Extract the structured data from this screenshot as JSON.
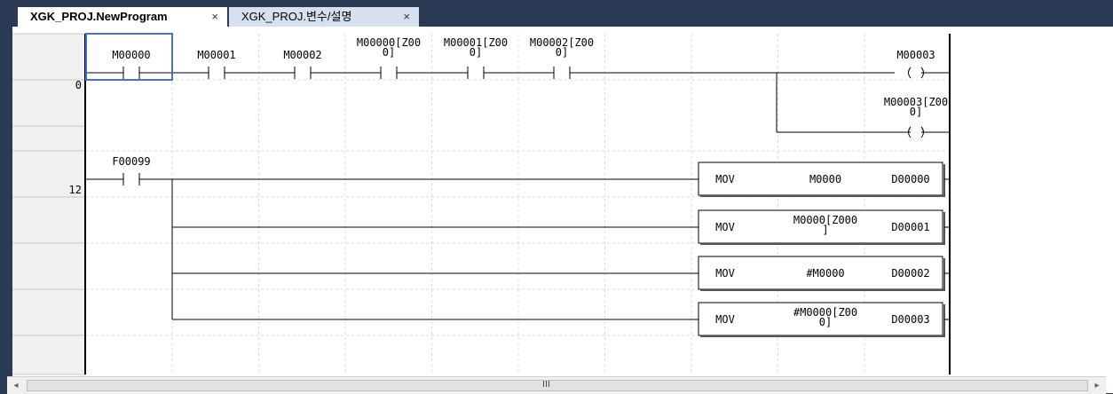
{
  "tabs": [
    {
      "label": "XGK_PROJ.NewProgram",
      "close": "×",
      "active": true
    },
    {
      "label": "XGK_PROJ.변수/설명",
      "close": "×",
      "active": false
    }
  ],
  "rungs": [
    {
      "number": "0",
      "contacts": [
        {
          "lines": [
            "M00000"
          ]
        },
        {
          "lines": [
            "M00001"
          ]
        },
        {
          "lines": [
            "M00002"
          ]
        },
        {
          "lines": [
            "M00000[Z00",
            "0]"
          ]
        },
        {
          "lines": [
            "M00001[Z00",
            "0]"
          ]
        },
        {
          "lines": [
            "M00002[Z00",
            "0]"
          ]
        }
      ],
      "coils": [
        {
          "lines": [
            "M00003"
          ]
        },
        {
          "lines": [
            "M00003[Z00",
            "0]"
          ]
        }
      ]
    },
    {
      "number": "12",
      "contact": {
        "lines": [
          "F00099"
        ]
      },
      "functions": [
        {
          "op": "MOV",
          "src": [
            "M0000"
          ],
          "dst": "D00000"
        },
        {
          "op": "MOV",
          "src": [
            "M0000[Z000",
            "]"
          ],
          "dst": "D00001"
        },
        {
          "op": "MOV",
          "src": [
            "#M0000"
          ],
          "dst": "D00002"
        },
        {
          "op": "MOV",
          "src": [
            "#M0000[Z00",
            "0]"
          ],
          "dst": "D00003"
        }
      ]
    }
  ],
  "scrollbar": {
    "left_arrow": "◂",
    "right_arrow": "▸",
    "grip": "III"
  },
  "colors": {
    "frame": "#2b3a55",
    "rung_number": "#1a4fd8",
    "cursor": "#4a6fd0",
    "grid": "#d8d8d8"
  }
}
